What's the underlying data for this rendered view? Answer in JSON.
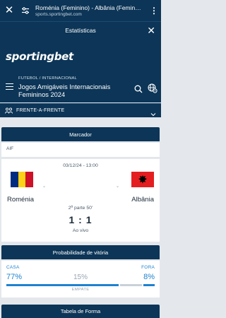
{
  "browser": {
    "close": "✕",
    "page_title": "Roménia (Feminino) - Albânia (Femin…",
    "url": "sports.sportingbet.com",
    "more": "⋮"
  },
  "stats_header": {
    "title": "Estatísticas",
    "close": "✕"
  },
  "brand": {
    "logo_a": "sporting",
    "logo_b": "bet"
  },
  "competition": {
    "breadcrumb": "FUTEBOL / INTERNACIONAL",
    "name": "Jogos Amigáveis Internacionais Femininos 2024"
  },
  "head_to_head": {
    "label": "FRENTE-A-FRENTE"
  },
  "marcador": {
    "title": "Marcador",
    "league": "AIF",
    "date": "03/12/24 - 13:00",
    "home": {
      "name": "Roménia",
      "flag": [
        "#002b7f",
        "#fcd116",
        "#ce1126"
      ]
    },
    "away": {
      "name": "Albânia",
      "flag_color": "#e41e20"
    },
    "period": "2ª parte 50'",
    "score": "1 : 1",
    "status": "Ao vivo"
  },
  "probability": {
    "title": "Probabilidade de vitória",
    "home_label": "CASA",
    "home_pct": "77%",
    "draw_pct": "15%",
    "away_label": "FORA",
    "away_pct": "8%",
    "draw_label": "EMPATE",
    "home_share": 0.77,
    "draw_share": 0.15,
    "away_share": 0.08,
    "colors": {
      "home": "#1e82d0",
      "draw": "#c9d1da",
      "away": "#1e82d0"
    }
  },
  "form_table": {
    "title": "Tabela de Forma"
  },
  "colors": {
    "brand_navy": "#0c3557",
    "accent_blue": "#1e82d0"
  }
}
